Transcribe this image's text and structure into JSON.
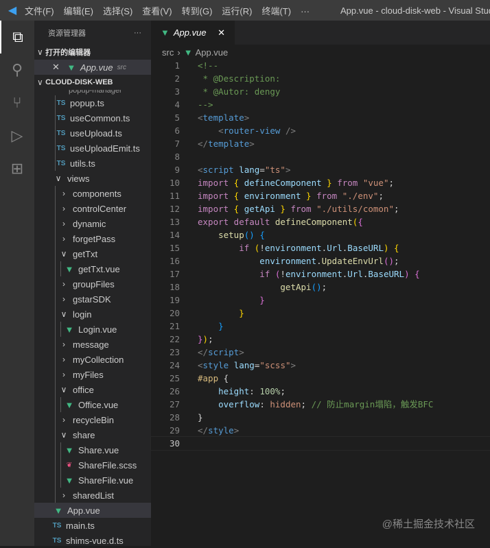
{
  "titlebar": {
    "menus": [
      "文件(F)",
      "编辑(E)",
      "选择(S)",
      "查看(V)",
      "转到(G)",
      "运行(R)",
      "终端(T)",
      "···"
    ],
    "title": "App.vue - cloud-disk-web - Visual Studio"
  },
  "activity": [
    "explorer-icon",
    "search-icon",
    "source-control-icon",
    "run-debug-icon",
    "extensions-icon"
  ],
  "sidebar": {
    "title": "资源管理器",
    "more": "···",
    "open_editors": "打开的编辑器",
    "open_file": "App.vue",
    "open_file_dir": "src",
    "project": "CLOUD-DISK-WEB",
    "items": [
      {
        "label": "popup.ts",
        "type": "ts",
        "depth": 1
      },
      {
        "label": "useCommon.ts",
        "type": "ts",
        "depth": 1
      },
      {
        "label": "useUpload.ts",
        "type": "ts",
        "depth": 1
      },
      {
        "label": "useUploadEmit.ts",
        "type": "ts",
        "depth": 1
      },
      {
        "label": "utils.ts",
        "type": "ts",
        "depth": 1
      },
      {
        "label": "views",
        "type": "open",
        "depth": 0
      },
      {
        "label": "components",
        "type": "closed",
        "depth": 1
      },
      {
        "label": "controlCenter",
        "type": "closed",
        "depth": 1
      },
      {
        "label": "dynamic",
        "type": "closed",
        "depth": 1
      },
      {
        "label": "forgetPass",
        "type": "closed",
        "depth": 1
      },
      {
        "label": "getTxt",
        "type": "open",
        "depth": 1
      },
      {
        "label": "getTxt.vue",
        "type": "vue",
        "depth": 2
      },
      {
        "label": "groupFiles",
        "type": "closed",
        "depth": 1
      },
      {
        "label": "gstarSDK",
        "type": "closed",
        "depth": 1
      },
      {
        "label": "login",
        "type": "open",
        "depth": 1
      },
      {
        "label": "Login.vue",
        "type": "vue",
        "depth": 2
      },
      {
        "label": "message",
        "type": "closed",
        "depth": 1
      },
      {
        "label": "myCollection",
        "type": "closed",
        "depth": 1
      },
      {
        "label": "myFiles",
        "type": "closed",
        "depth": 1
      },
      {
        "label": "office",
        "type": "open",
        "depth": 1
      },
      {
        "label": "Office.vue",
        "type": "vue",
        "depth": 2
      },
      {
        "label": "recycleBin",
        "type": "closed",
        "depth": 1
      },
      {
        "label": "share",
        "type": "open",
        "depth": 1
      },
      {
        "label": "Share.vue",
        "type": "vue",
        "depth": 2
      },
      {
        "label": "ShareFile.scss",
        "type": "scss",
        "depth": 2
      },
      {
        "label": "ShareFile.vue",
        "type": "vue",
        "depth": 2
      },
      {
        "label": "sharedList",
        "type": "closed",
        "depth": 1
      },
      {
        "label": "App.vue",
        "type": "vue",
        "depth": 0,
        "selected": true
      },
      {
        "label": "main.ts",
        "type": "ts",
        "depth": -1
      },
      {
        "label": "shims-vue.d.ts",
        "type": "ts",
        "depth": -1
      }
    ]
  },
  "editor": {
    "tab": "App.vue",
    "breadcrumb": [
      "src",
      "App.vue"
    ],
    "current_line": 30,
    "lines": [
      [
        [
          "<!--",
          "c"
        ]
      ],
      [
        [
          " * @Description:",
          "c"
        ]
      ],
      [
        [
          " * @Autor: dengy",
          "c"
        ]
      ],
      [
        [
          "-->",
          "c"
        ]
      ],
      [
        [
          "<",
          "t"
        ],
        [
          "template",
          "tn"
        ],
        [
          ">",
          "t"
        ]
      ],
      [
        [
          "    <",
          "t"
        ],
        [
          "router-view",
          "tn"
        ],
        [
          " />",
          "t"
        ]
      ],
      [
        [
          "</",
          "t"
        ],
        [
          "template",
          "tn"
        ],
        [
          ">",
          "t"
        ]
      ],
      [],
      [
        [
          "<",
          "t"
        ],
        [
          "script",
          "tn"
        ],
        [
          " lang",
          "at"
        ],
        [
          "=",
          "p"
        ],
        [
          "\"ts\"",
          "s"
        ],
        [
          ">",
          "t"
        ]
      ],
      [
        [
          "import",
          "k"
        ],
        [
          " { ",
          "b1"
        ],
        [
          "defineComponent",
          "v"
        ],
        [
          " } ",
          "b1"
        ],
        [
          "from",
          "k"
        ],
        [
          " \"vue\"",
          "s"
        ],
        [
          ";",
          "p"
        ]
      ],
      [
        [
          "import",
          "k"
        ],
        [
          " { ",
          "b1"
        ],
        [
          "environment",
          "v"
        ],
        [
          " } ",
          "b1"
        ],
        [
          "from",
          "k"
        ],
        [
          " \"./env\"",
          "s"
        ],
        [
          ";",
          "p"
        ]
      ],
      [
        [
          "import",
          "k"
        ],
        [
          " { ",
          "b1"
        ],
        [
          "getApi",
          "v"
        ],
        [
          " } ",
          "b1"
        ],
        [
          "from",
          "k"
        ],
        [
          " \"./utils/comon\"",
          "s"
        ],
        [
          ";",
          "p"
        ]
      ],
      [
        [
          "export",
          "k"
        ],
        [
          " default ",
          "k"
        ],
        [
          "defineComponent",
          "f"
        ],
        [
          "(",
          "b1"
        ],
        [
          "{",
          "b2"
        ]
      ],
      [
        [
          "    setup",
          "f"
        ],
        [
          "()",
          "b3"
        ],
        [
          " {",
          "b3"
        ]
      ],
      [
        [
          "        if ",
          "k"
        ],
        [
          "(",
          "b1"
        ],
        [
          "!",
          "p"
        ],
        [
          "environment",
          "v"
        ],
        [
          ".",
          "p"
        ],
        [
          "Url",
          "v"
        ],
        [
          ".",
          "p"
        ],
        [
          "BaseURL",
          "v"
        ],
        [
          ")",
          "b1"
        ],
        [
          " {",
          "b1"
        ]
      ],
      [
        [
          "            environment",
          "v"
        ],
        [
          ".",
          "p"
        ],
        [
          "UpdateEnvUrl",
          "f"
        ],
        [
          "()",
          "b2"
        ],
        [
          ";",
          "p"
        ]
      ],
      [
        [
          "            if ",
          "k"
        ],
        [
          "(",
          "b2"
        ],
        [
          "!",
          "p"
        ],
        [
          "environment",
          "v"
        ],
        [
          ".",
          "p"
        ],
        [
          "Url",
          "v"
        ],
        [
          ".",
          "p"
        ],
        [
          "BaseURL",
          "v"
        ],
        [
          ")",
          "b2"
        ],
        [
          " {",
          "b2"
        ]
      ],
      [
        [
          "                getApi",
          "f"
        ],
        [
          "()",
          "b3"
        ],
        [
          ";",
          "p"
        ]
      ],
      [
        [
          "            }",
          "b2"
        ]
      ],
      [
        [
          "        }",
          "b1"
        ]
      ],
      [
        [
          "    }",
          "b3"
        ]
      ],
      [
        [
          "}",
          "b2"
        ],
        [
          ")",
          "b1"
        ],
        [
          ";",
          "p"
        ]
      ],
      [
        [
          "</",
          "t"
        ],
        [
          "script",
          "tn"
        ],
        [
          ">",
          "t"
        ]
      ],
      [
        [
          "<",
          "t"
        ],
        [
          "style",
          "tn"
        ],
        [
          " lang",
          "at"
        ],
        [
          "=",
          "p"
        ],
        [
          "\"scss\"",
          "s"
        ],
        [
          ">",
          "t"
        ]
      ],
      [
        [
          "#app",
          "sel2"
        ],
        [
          " {",
          "p"
        ]
      ],
      [
        [
          "    height",
          "at"
        ],
        [
          ": ",
          "p"
        ],
        [
          "100%",
          "cv"
        ],
        [
          ";",
          "p"
        ]
      ],
      [
        [
          "    overflow",
          "at"
        ],
        [
          ": ",
          "p"
        ],
        [
          "hidden",
          "s"
        ],
        [
          "; ",
          "p"
        ],
        [
          "// 防止margin塌陷，触发BFC",
          "c"
        ]
      ],
      [
        [
          "}",
          "p"
        ]
      ],
      [
        [
          "</",
          "t"
        ],
        [
          "style",
          "tn"
        ],
        [
          ">",
          "t"
        ]
      ],
      []
    ]
  },
  "watermark": "@稀土掘金技术社区"
}
